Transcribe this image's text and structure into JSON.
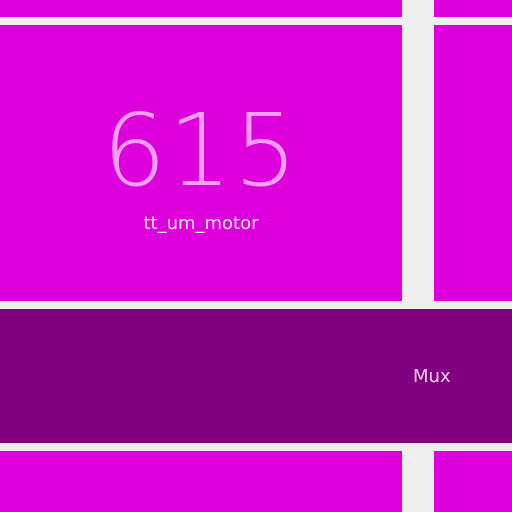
{
  "colors": {
    "background": "#eeeeee",
    "tile_magenta": "#dd00dd",
    "tile_purple": "#800080",
    "counter_text": "#f3a0f3"
  },
  "counter_tile": {
    "value": "615",
    "label": "tt_um_motor"
  },
  "mux_tile": {
    "label": "Mux"
  }
}
